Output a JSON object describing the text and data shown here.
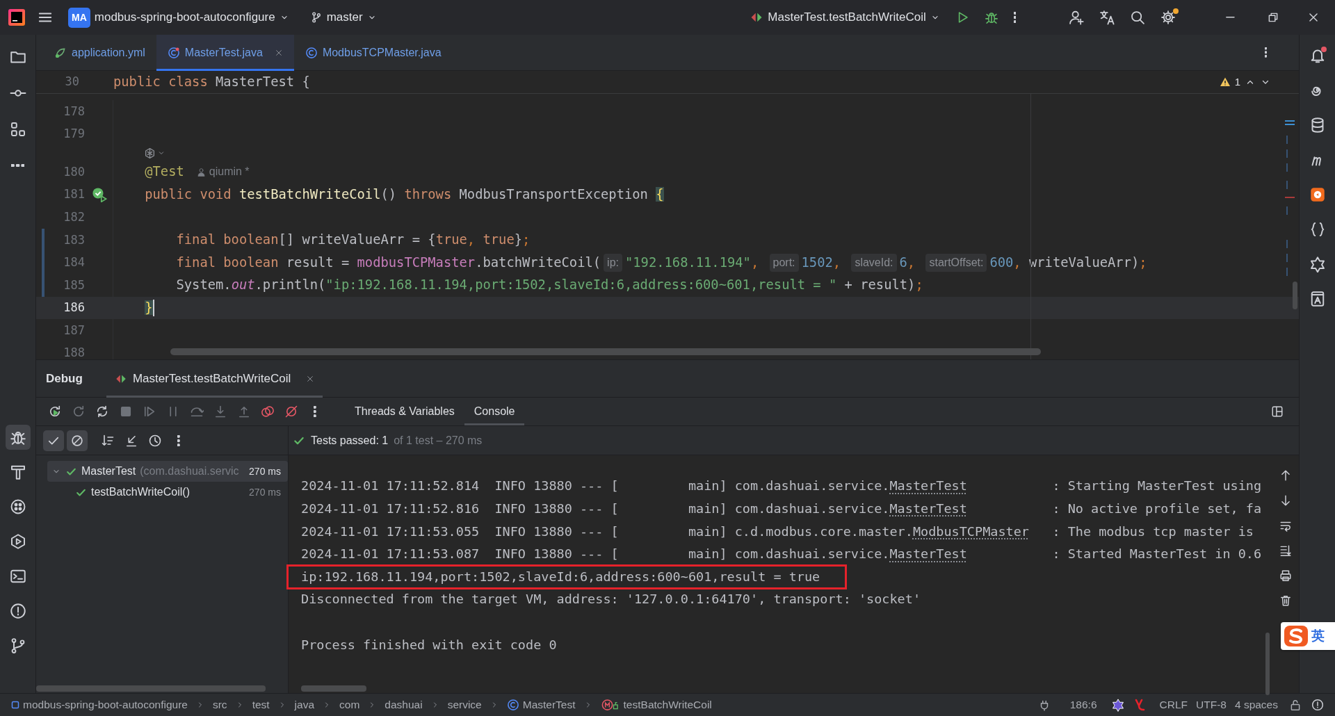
{
  "title_bar": {
    "project_badge": "MA",
    "project": "modbus-spring-boot-autoconfigure",
    "branch": "master",
    "run_config": "MasterTest.testBatchWriteCoil",
    "settings_update": true
  },
  "tool_windows_left": {
    "top": [
      {
        "kind": "project",
        "selected": false
      },
      {
        "kind": "commit",
        "selected": false
      },
      {
        "kind": "structure",
        "selected": false
      },
      {
        "kind": "more",
        "selected": false
      }
    ],
    "bottom": [
      {
        "kind": "debug",
        "selected": true
      },
      {
        "kind": "build",
        "selected": false
      },
      {
        "kind": "services",
        "selected": false
      },
      {
        "kind": "run",
        "selected": false
      },
      {
        "kind": "terminal",
        "selected": false
      },
      {
        "kind": "problems",
        "selected": false
      },
      {
        "kind": "git",
        "selected": false
      }
    ]
  },
  "tool_windows_right": [
    {
      "kind": "notifications",
      "unread": true
    },
    {
      "kind": "copilot",
      "unread": false
    },
    {
      "kind": "database",
      "unread": false
    },
    {
      "kind": "maven",
      "unread": false
    },
    {
      "kind": "plugin",
      "unread": false
    },
    {
      "kind": "json",
      "unread": false
    },
    {
      "kind": "ai",
      "unread": false
    },
    {
      "kind": "bookmarks",
      "unread": false
    }
  ],
  "editor_tabs": [
    {
      "label": "application.yml",
      "kind": "yaml",
      "selected": false,
      "closable": false
    },
    {
      "label": "MasterTest.java",
      "kind": "class",
      "selected": true,
      "closable": true
    },
    {
      "label": "ModbusTCPMaster.java",
      "kind": "class",
      "selected": false,
      "closable": false
    }
  ],
  "sticky_line": {
    "number": "30",
    "tokens": [
      {
        "kind": "keyword",
        "text": "public class "
      },
      {
        "kind": "plain",
        "text": "MasterTest {"
      }
    ]
  },
  "problems_count": "1",
  "code_lines": [
    {
      "kind": "code",
      "number": "178",
      "current": false,
      "modified": false,
      "test_passed": false
    },
    {
      "kind": "code",
      "number": "179",
      "current": false,
      "modified": false,
      "test_passed": false
    },
    {
      "kind": "inlay"
    },
    {
      "kind": "code",
      "number": "180",
      "current": false,
      "modified": false,
      "test_passed": false,
      "tokens": [
        {
          "kind": "annotation",
          "text": "    @Test"
        },
        {
          "kind": "author",
          "text": "qiumin *"
        }
      ]
    },
    {
      "kind": "code",
      "number": "181",
      "current": false,
      "modified": false,
      "test_passed": true,
      "tokens": [
        {
          "kind": "keyword",
          "text": "    public void "
        },
        {
          "kind": "method",
          "text": "testBatchWriteCoil"
        },
        {
          "kind": "plain",
          "text": "() "
        },
        {
          "kind": "keyword",
          "text": "throws "
        },
        {
          "kind": "plain",
          "text": "ModbusTransportException "
        },
        {
          "kind": "brace-match",
          "text": "{"
        }
      ]
    },
    {
      "kind": "code",
      "number": "182",
      "current": false,
      "modified": false,
      "test_passed": false
    },
    {
      "kind": "code",
      "number": "183",
      "current": false,
      "modified": true,
      "test_passed": false,
      "tokens": [
        {
          "kind": "keyword",
          "text": "        final boolean"
        },
        {
          "kind": "plain",
          "text": "[] writeValueArr = {"
        },
        {
          "kind": "keyword",
          "text": "true"
        },
        {
          "kind": "punct",
          "text": ", "
        },
        {
          "kind": "keyword",
          "text": "true"
        },
        {
          "kind": "plain",
          "text": "}"
        },
        {
          "kind": "punct",
          "text": ";"
        }
      ]
    },
    {
      "kind": "code",
      "number": "184",
      "current": false,
      "modified": true,
      "test_passed": false,
      "tokens": [
        {
          "kind": "keyword",
          "text": "        final boolean "
        },
        {
          "kind": "plain",
          "text": "result = "
        },
        {
          "kind": "field",
          "text": "modbusTCPMaster"
        },
        {
          "kind": "plain",
          "text": ".batchWriteCoil("
        },
        {
          "kind": "hint",
          "text": "ip:"
        },
        {
          "kind": "string",
          "text": "\"192.168.11.194\""
        },
        {
          "kind": "punct",
          "text": ", "
        },
        {
          "kind": "hint",
          "text": "port:"
        },
        {
          "kind": "number",
          "text": "1502"
        },
        {
          "kind": "punct",
          "text": ", "
        },
        {
          "kind": "hint",
          "text": "slaveId:"
        },
        {
          "kind": "number",
          "text": "6"
        },
        {
          "kind": "punct",
          "text": ", "
        },
        {
          "kind": "hint",
          "text": "startOffset:"
        },
        {
          "kind": "number",
          "text": "600"
        },
        {
          "kind": "punct",
          "text": ", "
        },
        {
          "kind": "plain",
          "text": "writeValueArr)"
        },
        {
          "kind": "punct",
          "text": ";"
        }
      ]
    },
    {
      "kind": "code",
      "number": "185",
      "current": false,
      "modified": true,
      "test_passed": false,
      "tokens": [
        {
          "kind": "plain",
          "text": "        System."
        },
        {
          "kind": "static",
          "text": "out"
        },
        {
          "kind": "plain",
          "text": ".println("
        },
        {
          "kind": "string",
          "text": "\"ip:192.168.11.194,port:1502,slaveId:6,address:600~601,result = \""
        },
        {
          "kind": "plain",
          "text": " + result)"
        },
        {
          "kind": "punct",
          "text": ";"
        }
      ]
    },
    {
      "kind": "code",
      "number": "186",
      "current": true,
      "modified": false,
      "test_passed": false,
      "tokens": [
        {
          "kind": "brace-match",
          "text": "    }"
        }
      ]
    },
    {
      "kind": "code",
      "number": "187",
      "current": false,
      "modified": false,
      "test_passed": false
    },
    {
      "kind": "code",
      "number": "188",
      "current": false,
      "modified": false,
      "test_passed": false
    }
  ],
  "debug": {
    "title": "Debug",
    "session_tab": "MasterTest.testBatchWriteCoil",
    "view_tabs": [
      {
        "label": "Threads & Variables",
        "selected": false
      },
      {
        "label": "Console",
        "selected": true
      }
    ],
    "filters": [
      {
        "kind": "show-passed",
        "on": true
      },
      {
        "kind": "show-ignored",
        "on": true
      }
    ],
    "summary": {
      "status": "Tests passed: 1",
      "detail": "of 1 test – 270 ms"
    },
    "tree": [
      {
        "name": "MasterTest",
        "detail": "(com.dashuai.servic",
        "time": "270 ms",
        "passed": true,
        "selected": true,
        "expanded": true,
        "children": [
          {
            "name": "testBatchWriteCoil()",
            "time": "270 ms",
            "passed": true,
            "selected": false
          }
        ]
      }
    ]
  },
  "console": {
    "lines": [
      {
        "kind": "log",
        "prefix": "2024-11-01 17:11:52.814  INFO 13880 --- [         main] com.dashuai.service.",
        "link": "MasterTest",
        "suffix": "           : Starting MasterTest using",
        "highlighted": false
      },
      {
        "kind": "log",
        "prefix": "2024-11-01 17:11:52.816  INFO 13880 --- [         main] com.dashuai.service.",
        "link": "MasterTest",
        "suffix": "           : No active profile set, fa",
        "highlighted": false
      },
      {
        "kind": "log",
        "prefix": "2024-11-01 17:11:53.055  INFO 13880 --- [         main] c.d.modbus.core.master.",
        "link": "ModbusTCPMaster",
        "suffix": "   : The modbus tcp master is",
        "highlighted": false
      },
      {
        "kind": "log",
        "prefix": "2024-11-01 17:11:53.087  INFO 13880 --- [         main] com.dashuai.service.",
        "link": "MasterTest",
        "suffix": "           : Started MasterTest in 0.6",
        "highlighted": false
      },
      {
        "kind": "output",
        "text": "ip:192.168.11.194,port:1502,slaveId:6,address:600~601,result = true",
        "highlighted": true
      },
      {
        "kind": "output",
        "text": "Disconnected from the target VM, address: '127.0.0.1:64170', transport: 'socket'",
        "highlighted": false
      },
      {
        "kind": "blank",
        "highlighted": false
      },
      {
        "kind": "output",
        "text": "Process finished with exit code 0",
        "highlighted": false
      }
    ]
  },
  "status_bar": {
    "breadcrumbs": [
      {
        "label": "modbus-spring-boot-autoconfigure",
        "kind": "module"
      },
      {
        "label": "src",
        "kind": "folder"
      },
      {
        "label": "test",
        "kind": "folder"
      },
      {
        "label": "java",
        "kind": "folder"
      },
      {
        "label": "com",
        "kind": "folder"
      },
      {
        "label": "dashuai",
        "kind": "folder"
      },
      {
        "label": "service",
        "kind": "folder"
      },
      {
        "label": "MasterTest",
        "kind": "class"
      },
      {
        "label": "testBatchWriteCoil",
        "kind": "method"
      }
    ],
    "position": "186:6",
    "line_separator": "CRLF",
    "encoding": "UTF-8",
    "indent": "4 spaces"
  },
  "ime": {
    "mode": "英"
  }
}
